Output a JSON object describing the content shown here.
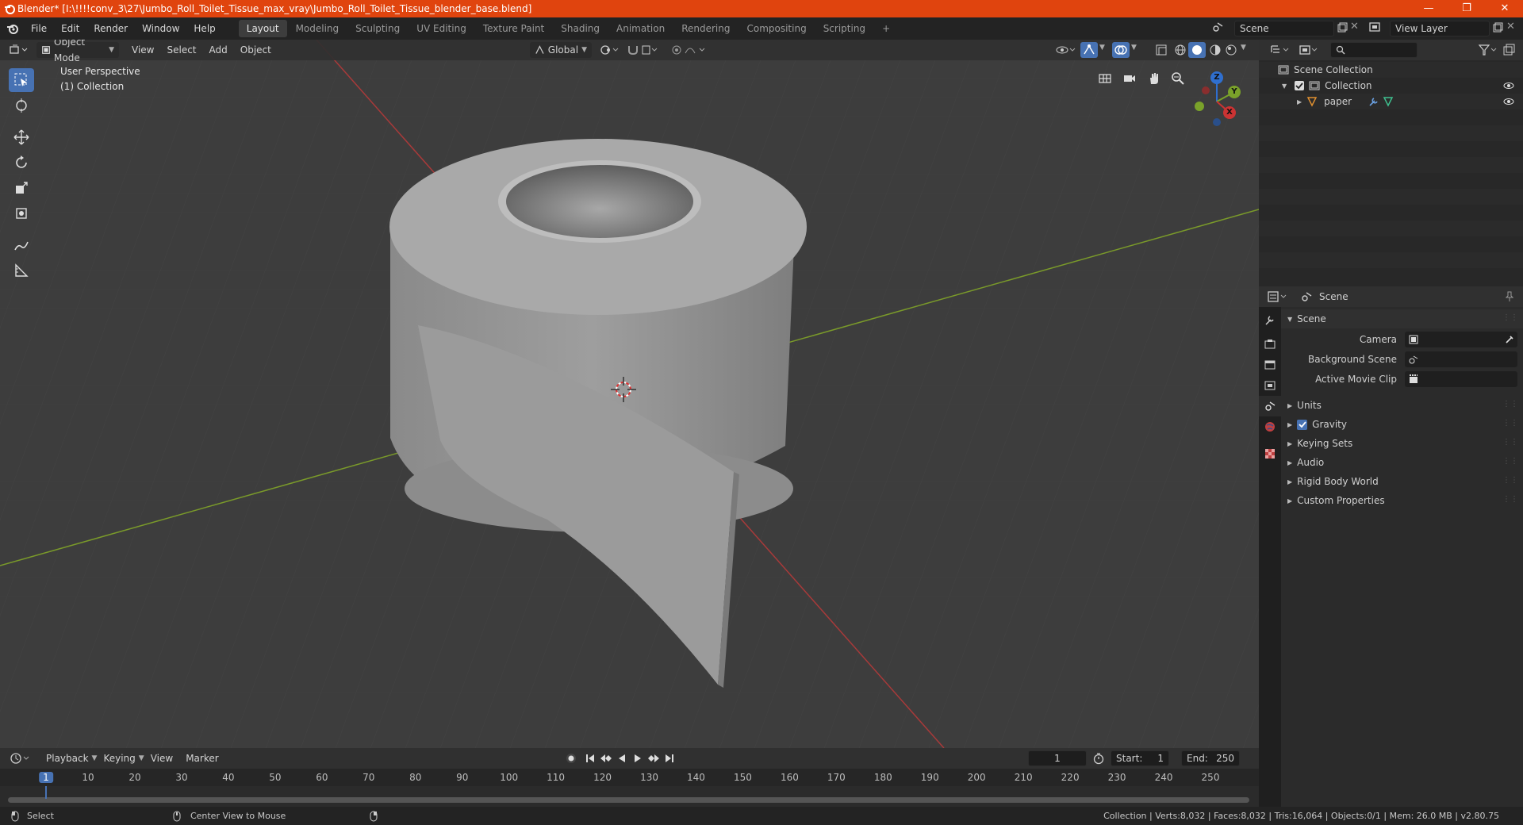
{
  "window": {
    "title": "Blender* [I:\\!!!!conv_3\\27\\Jumbo_Roll_Toilet_Tissue_max_vray\\Jumbo_Roll_Toilet_Tissue_blender_base.blend]",
    "minimize": "—",
    "maximize": "❐",
    "close": "✕"
  },
  "menubar": {
    "items": [
      "File",
      "Edit",
      "Render",
      "Window",
      "Help"
    ]
  },
  "workspaces": {
    "tabs": [
      "Layout",
      "Modeling",
      "Sculpting",
      "UV Editing",
      "Texture Paint",
      "Shading",
      "Animation",
      "Rendering",
      "Compositing",
      "Scripting"
    ],
    "active": "Layout",
    "add": "+"
  },
  "scene_selector": {
    "value": "Scene"
  },
  "view_layer_selector": {
    "value": "View Layer"
  },
  "viewport_header": {
    "mode": "Object Mode",
    "menus": [
      "View",
      "Select",
      "Add",
      "Object"
    ],
    "transform_orientation": "Global"
  },
  "viewport": {
    "perspective_label": "User Perspective",
    "collection_label": "(1) Collection",
    "axes": {
      "z": "Z",
      "y": "Y",
      "x": "X"
    }
  },
  "outliner": {
    "search_placeholder": "",
    "rows": [
      {
        "label": "Scene Collection"
      },
      {
        "label": "Collection"
      },
      {
        "label": "paper"
      }
    ]
  },
  "properties": {
    "context": "Scene",
    "panel_title": "Scene",
    "fields": [
      {
        "label": "Camera",
        "value": ""
      },
      {
        "label": "Background Scene",
        "value": ""
      },
      {
        "label": "Active Movie Clip",
        "value": ""
      }
    ],
    "sections": [
      "Units",
      "Gravity",
      "Keying Sets",
      "Audio",
      "Rigid Body World",
      "Custom Properties"
    ],
    "gravity_checked": true
  },
  "timeline": {
    "menus": [
      "Playback",
      "Keying",
      "View",
      "Marker"
    ],
    "current_frame": "1",
    "start_label": "Start:",
    "start_value": "1",
    "end_label": "End:",
    "end_value": "250",
    "ticks": [
      "1",
      "10",
      "20",
      "30",
      "40",
      "50",
      "60",
      "70",
      "80",
      "90",
      "100",
      "110",
      "120",
      "130",
      "140",
      "150",
      "160",
      "170",
      "180",
      "190",
      "200",
      "210",
      "220",
      "230",
      "240",
      "250"
    ],
    "playhead_frame": 1
  },
  "statusbar": {
    "left_action": "Select",
    "middle_action": "Center View to Mouse",
    "stats": "Collection | Verts:8,032 | Faces:8,032 | Tris:16,064 | Objects:0/1 | Mem: 26.0 MB | v2.80.75"
  },
  "colors": {
    "title_bar": "#e0440e",
    "accent": "#4772b3",
    "viewport_bg": "#3d3d3d",
    "x_axis": "#a83a3a",
    "y_axis": "#7a9a2a"
  }
}
